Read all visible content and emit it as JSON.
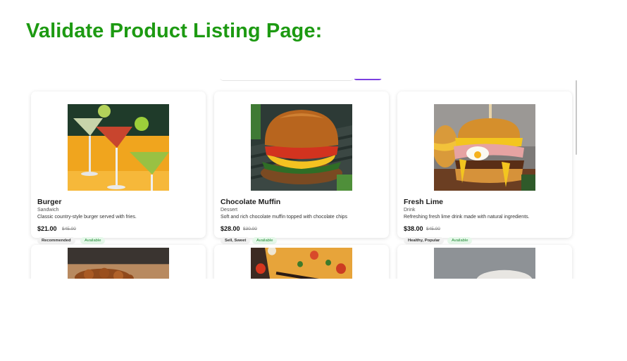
{
  "page": {
    "title": "Validate Product Listing Page:"
  },
  "products": [
    {
      "name": "Burger",
      "category": "Sandwich",
      "description": "Classic country-style burger served with fries.",
      "price": "$21.00",
      "old_price": "$45.00",
      "tags": "Recommended",
      "status": "Available",
      "image_icon": "cocktails-image"
    },
    {
      "name": "Chocolate Muffin",
      "category": "Dessert",
      "description": "Soft and rich chocolate muffin topped with chocolate chips",
      "price": "$28.00",
      "old_price": "$30.00",
      "tags": "Sell, Sweet",
      "status": "Available",
      "image_icon": "burger-image"
    },
    {
      "name": "Fresh Lime",
      "category": "Drink",
      "description": "Refreshing fresh lime drink made with natural ingredients.",
      "price": "$38.00",
      "old_price": "$45.00",
      "tags": "Healthy, Popular",
      "status": "Available",
      "image_icon": "burger-image"
    }
  ],
  "colors": {
    "title": "#1d9a12",
    "accent": "#7b3fe0",
    "status_text": "#1f8a33",
    "status_bg": "#e6f8ea"
  }
}
